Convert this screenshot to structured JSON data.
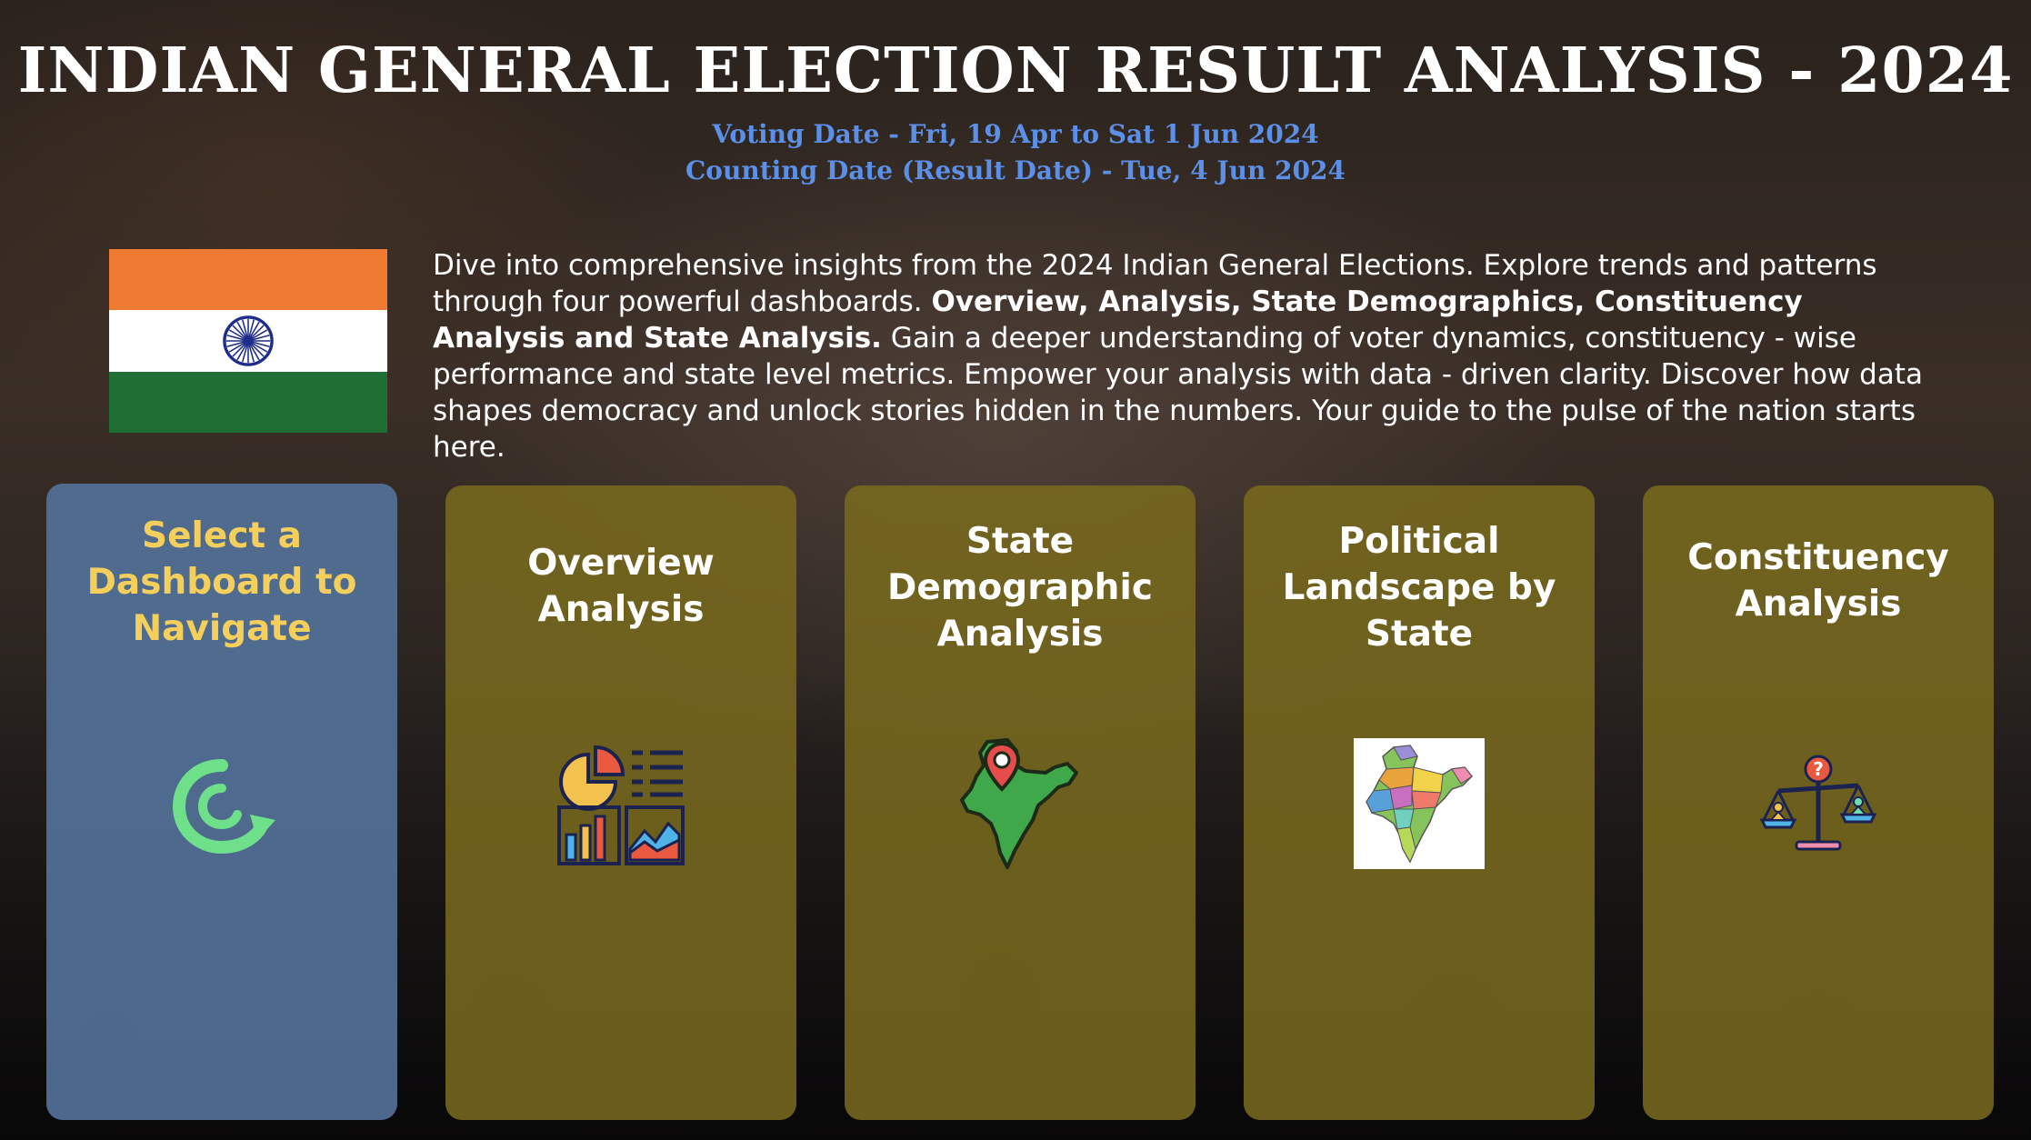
{
  "header": {
    "title": "INDIAN GENERAL ELECTION RESULT ANALYSIS - 2024",
    "voting_date": "Voting Date - Fri, 19 Apr to Sat 1 Jun 2024",
    "counting_date": "Counting Date (Result Date) - Tue, 4 Jun 2024"
  },
  "intro": {
    "part1": "Dive into comprehensive insights from the 2024 Indian General Elections. Explore trends and patterns through four powerful dashboards. ",
    "bold": "Overview, Analysis, State Demographics, Constituency Analysis and State Analysis.",
    "part2": " Gain a deeper understanding of voter dynamics, constituency - wise performance and state level metrics. Empower your analysis with data - driven clarity. Discover how data shapes democracy and unlock stories hidden in the numbers. Your guide to the pulse of the nation starts here."
  },
  "cards": [
    {
      "title": "Select a Dashboard to Navigate",
      "icon": "navigate-arrow-icon"
    },
    {
      "title": "Overview Analysis",
      "icon": "analytics-icon"
    },
    {
      "title": "State Demographic Analysis",
      "icon": "india-map-pin-icon"
    },
    {
      "title": "Political Landscape by State",
      "icon": "india-states-map-icon"
    },
    {
      "title": "Constituency Analysis",
      "icon": "balance-scale-icon"
    }
  ],
  "colors": {
    "accent_blue": "#5b8fe8",
    "card_gold": "#786a1e",
    "card_active": "#527198",
    "active_title": "#f4cf5c"
  }
}
